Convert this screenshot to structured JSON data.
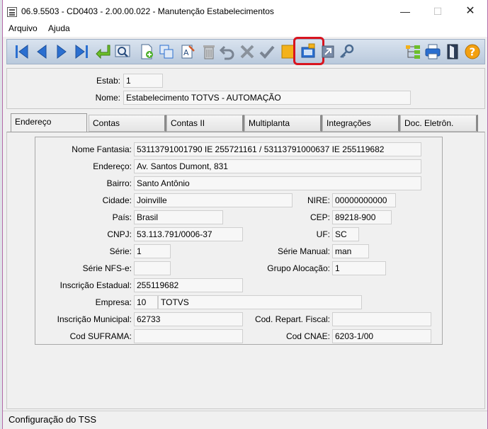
{
  "window": {
    "title": "06.9.5503 - CD0403 - 2.00.00.022 - Manutenção Estabelecimentos",
    "minimize": "—",
    "maximize": "☐",
    "close": "✕"
  },
  "menu": [
    "Arquivo",
    "Ajuda"
  ],
  "toolbar": {
    "buttons": [
      "first-icon",
      "previous-icon",
      "next-icon",
      "last-icon",
      "goto-icon",
      "search-icon",
      "new-icon",
      "copy-icon",
      "edit-icon",
      "delete-icon",
      "undo-icon",
      "cancel-icon",
      "confirm-icon",
      "notes-icon",
      "highlighted-config-icon",
      "import-icon",
      "key-icon",
      "hierarchy-icon",
      "print-icon",
      "exit-icon",
      "help-icon"
    ],
    "highlight_color": "#d8141f"
  },
  "header": {
    "estab_label": "Estab:",
    "estab_value": "1",
    "nome_label": "Nome:",
    "nome_value": "Estabelecimento TOTVS - AUTOMAÇÃO"
  },
  "tabs": [
    "Endereço",
    "Contas",
    "Contas II",
    "Multiplanta",
    "Integrações",
    "Doc. Eletrôn."
  ],
  "form": {
    "nome_fantasia_label": "Nome Fantasia:",
    "nome_fantasia": "53113791001790 IE 255721161 / 53113791000637 IE 255119682",
    "endereco_label": "Endereço:",
    "endereco": "Av. Santos Dumont, 831",
    "bairro_label": "Bairro:",
    "bairro": "Santo Antônio",
    "cidade_label": "Cidade:",
    "cidade": "Joinville",
    "nire_label": "NIRE:",
    "nire": "00000000000",
    "pais_label": "País:",
    "pais": "Brasil",
    "cep_label": "CEP:",
    "cep": "89218-900",
    "cnpj_label": "CNPJ:",
    "cnpj": "53.113.791/0006-37",
    "uf_label": "UF:",
    "uf": "SC",
    "serie_label": "Série:",
    "serie": "1",
    "serie_manual_label": "Série Manual:",
    "serie_manual": "man",
    "serie_nfse_label": "Série NFS-e:",
    "serie_nfse": "",
    "grupo_alocacao_label": "Grupo Alocação:",
    "grupo_alocacao": "1",
    "inscricao_estadual_label": "Inscrição Estadual:",
    "inscricao_estadual": "255119682",
    "empresa_label": "Empresa:",
    "empresa_codigo": "10",
    "empresa_nome": "TOTVS",
    "inscricao_municipal_label": "Inscrição Municipal:",
    "inscricao_municipal": "62733",
    "cod_repart_fiscal_label": "Cod. Repart. Fiscal:",
    "cod_repart_fiscal": "",
    "cod_suframa_label": "Cod SUFRAMA:",
    "cod_suframa": "",
    "cod_cnae_label": "Cod CNAE:",
    "cod_cnae": "6203-1/00"
  },
  "status": {
    "text": "Configuração do TSS"
  }
}
